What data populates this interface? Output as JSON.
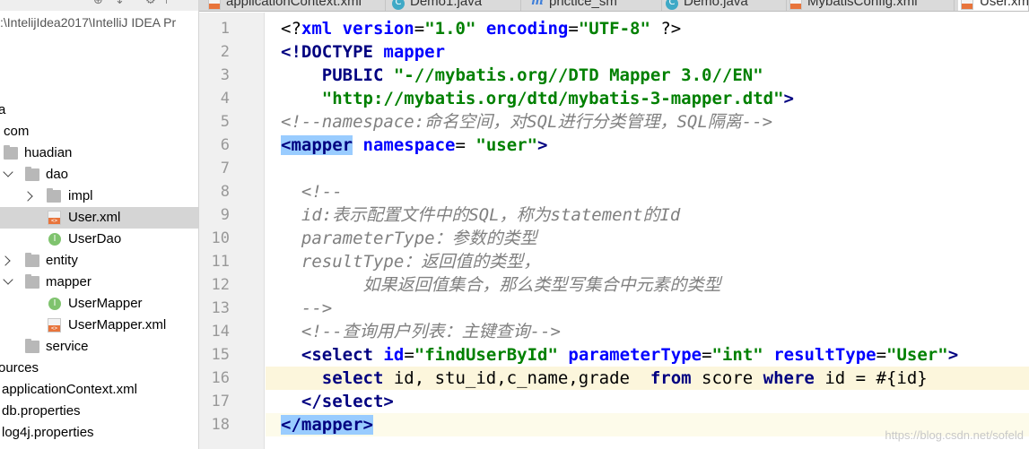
{
  "project": {
    "root_path": ":\\IntelijIdea2017\\IntelliJ IDEA Pr",
    "items": [
      {
        "label": "a",
        "indent": "none",
        "type": "text"
      },
      {
        "label": "com",
        "indent": "none",
        "type": "text"
      },
      {
        "label": "huadian",
        "type": "folder"
      },
      {
        "label": "dao",
        "type": "folder",
        "expanded": true
      },
      {
        "label": "impl",
        "type": "folder",
        "expanded": false
      },
      {
        "label": "User.xml",
        "type": "xml",
        "selected": true
      },
      {
        "label": "UserDao",
        "type": "interface"
      },
      {
        "label": "entity",
        "type": "folder",
        "expanded": false
      },
      {
        "label": "mapper",
        "type": "folder",
        "expanded": true
      },
      {
        "label": "UserMapper",
        "type": "interface"
      },
      {
        "label": "UserMapper.xml",
        "type": "xml"
      },
      {
        "label": "service",
        "type": "folder"
      },
      {
        "label": "ources",
        "type": "text"
      },
      {
        "label": "applicationContext.xml",
        "type": "text"
      },
      {
        "label": "db.properties",
        "type": "properties"
      },
      {
        "label": "log4j.properties",
        "type": "properties"
      }
    ]
  },
  "tabs": [
    {
      "label": "applicationContext.xml",
      "icon": "xml-icon"
    },
    {
      "label": "Demo1.java",
      "icon": "class-icon"
    },
    {
      "label": "prictice_sm",
      "icon": "module-icon"
    },
    {
      "label": "Demo.java",
      "icon": "class-icon"
    },
    {
      "label": "MybatisConfig.xml",
      "icon": "xml-icon"
    },
    {
      "label": "User.xm",
      "icon": "xml-icon",
      "active": true
    }
  ],
  "line_numbers": [
    "1",
    "2",
    "3",
    "4",
    "5",
    "6",
    "7",
    "8",
    "9",
    "10",
    "11",
    "12",
    "13",
    "14",
    "15",
    "16",
    "17",
    "18"
  ],
  "code": {
    "l1": {
      "open": "<?",
      "decl": "xml",
      "sp1": " ",
      "a1": "version",
      "eq1": "=",
      "v1": "\"1.0\"",
      "sp2": " ",
      "a2": "encoding",
      "eq2": "=",
      "v2": "\"UTF-8\"",
      "close": " ?>"
    },
    "l2": {
      "tag": "<!DOCTYPE",
      "sp": " ",
      "name": "mapper"
    },
    "l3": {
      "indent": "    ",
      "kw": "PUBLIC",
      "sp": " ",
      "val": "\"-//mybatis.org//DTD Mapper 3.0//EN\""
    },
    "l4": {
      "indent": "    ",
      "val": "\"http://mybatis.org/dtd/mybatis-3-mapper.dtd\"",
      "close": ">"
    },
    "l5": {
      "comment": "<!--namespace:命名空间，对SQL进行分类管理，SQL隔离-->"
    },
    "l6": {
      "tag": "<mapper",
      "sp": " ",
      "attr": "namespace",
      "eq": "=",
      "sp2": " ",
      "val": "\"user\"",
      "close": ">"
    },
    "l8": {
      "comment": "  <!--"
    },
    "l9": {
      "comment": "  id:表示配置文件中的SQL，称为statement的Id"
    },
    "l10": {
      "comment": "  parameterType：参数的类型"
    },
    "l11": {
      "comment": "  resultType：返回值的类型，"
    },
    "l12": {
      "comment": "        如果返回值集合，那么类型写集合中元素的类型"
    },
    "l13": {
      "comment": "  -->"
    },
    "l14": {
      "comment": "  <!--查询用户列表：主键查询-->"
    },
    "l15": {
      "indent": "  ",
      "tag": "<select",
      "sp1": " ",
      "a1": "id",
      "eq1": "=",
      "v1": "\"findUserById\"",
      "sp2": " ",
      "a2": "parameterType",
      "eq2": "=",
      "v2": "\"int\"",
      "sp3": " ",
      "a3": "resultType",
      "eq3": "=",
      "v3": "\"User\"",
      "close": ">"
    },
    "l16": {
      "indent": "    ",
      "kw1": "select",
      "t1": " id, stu_id,c_name,grade  ",
      "kw2": "from",
      "t2": " score ",
      "kw3": "where",
      "t3": " id = #{id}"
    },
    "l17": {
      "indent": "  ",
      "tag": "</select",
      "close": ">"
    },
    "l18": {
      "tag": "</mapper",
      "close": ">"
    }
  },
  "watermark": "https://blog.csdn.net/sofeld",
  "colors": {
    "tag": "#000080",
    "attribute": "#0000ff",
    "string": "#008000",
    "comment": "#808080",
    "brace_match": "#99ccff",
    "line_highlight": "#fcf6dc"
  }
}
